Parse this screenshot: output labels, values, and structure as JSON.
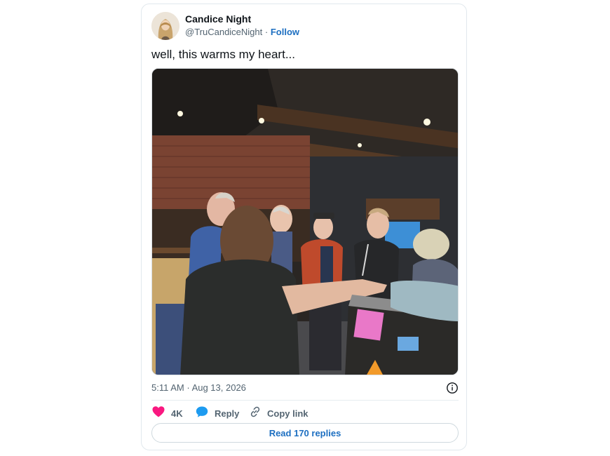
{
  "tweet": {
    "author_name": "Candice Night",
    "handle": "@TruCandiceNight",
    "separator": "·",
    "follow_label": "Follow",
    "text": "well, this warms my heart...",
    "timestamp": "5:11 AM · Aug 13, 2026"
  },
  "actions": {
    "like_count": "4K",
    "reply_label": "Reply",
    "copy_link_label": "Copy link"
  },
  "read_replies_label": "Read 170 replies",
  "icons": {
    "like": "heart-icon",
    "reply": "speech-bubble-icon",
    "copy": "link-icon",
    "info": "info-icon"
  },
  "colors": {
    "like": "#f91880",
    "reply": "#1d9bf0",
    "link": "#1d6fc1",
    "muted": "#536471"
  }
}
